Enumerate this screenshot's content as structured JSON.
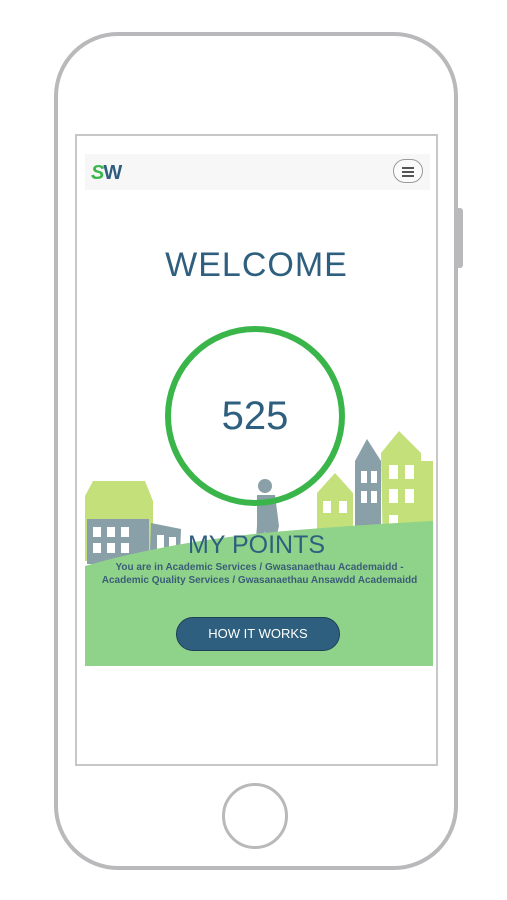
{
  "header": {
    "logo_s": "S",
    "logo_w": "W",
    "menu_icon": "hamburger-menu-icon"
  },
  "main": {
    "title": "WELCOME",
    "points": "525",
    "points_label": "MY POINTS",
    "department": "You are in Academic Services / Gwasanaethau Academaidd - Academic Quality Services / Gwasanaethau Ansawdd Academaidd",
    "button_label": "HOW IT WORKS"
  },
  "colors": {
    "accent": "#3ab54a",
    "brand": "#2f5f7e",
    "grass": "#8fd28a",
    "building_light": "#c4e07a",
    "building_dark": "#8aa0a9"
  }
}
